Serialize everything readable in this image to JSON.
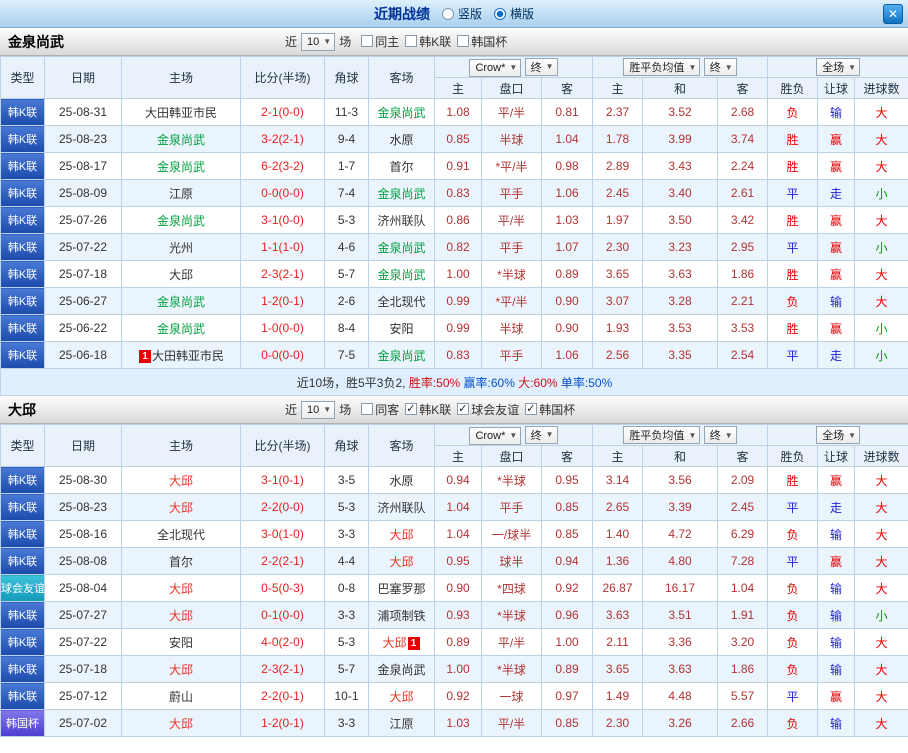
{
  "topbar": {
    "title": "近期战绩",
    "radio_vertical": "竖版",
    "radio_horizontal": "横版",
    "close_icon": "✕"
  },
  "filters_label": {
    "near": "近",
    "games": "场"
  },
  "header": {
    "cols": [
      "类型",
      "日期",
      "主场",
      "比分(半场)",
      "角球",
      "客场"
    ],
    "sub": [
      "主",
      "盘口",
      "客",
      "主",
      "和",
      "客",
      "胜负",
      "让球",
      "进球数"
    ],
    "selects": {
      "bookmaker": "Crow*",
      "final1": "终",
      "avg": "胜平负均值",
      "final2": "终",
      "scope": "全场"
    }
  },
  "colors": {
    "league_blue": "#1b4aab",
    "friendly_teal": "#149ab8",
    "cup_purple": "#4c3ecf",
    "result_red": "#e60000",
    "result_blue": "#2020d8",
    "result_green": "#0f9a10",
    "team_green": "#00a040",
    "team_red": "#ee3322",
    "score_red": "#e82020",
    "odds_red": "#b23333"
  },
  "sections": [
    {
      "team": "金泉尚武",
      "count": "10",
      "checks": [
        {
          "label": "同主",
          "on": false
        },
        {
          "label": "韩K联",
          "on": false
        },
        {
          "label": "韩国杯",
          "on": false
        }
      ],
      "rows": [
        {
          "type": "韩K联",
          "tc": "kl",
          "date": "25-08-31",
          "home": "大田韩亚市民",
          "hc": "",
          "hb": "",
          "score": "2-1(0-0)",
          "corners": "11-3",
          "away": "金泉尚武",
          "ac": "g",
          "ab": "",
          "odds": [
            "1.08",
            "平/半",
            "0.81"
          ],
          "euro": [
            "2.37",
            "3.52",
            "2.68"
          ],
          "res": [
            "负",
            "输",
            "大"
          ],
          "rc": [
            "r",
            "b",
            "r"
          ]
        },
        {
          "type": "韩K联",
          "tc": "kl",
          "date": "25-08-23",
          "home": "金泉尚武",
          "hc": "g",
          "hb": "",
          "score": "3-2(2-1)",
          "corners": "9-4",
          "away": "水原",
          "ac": "",
          "ab": "",
          "odds": [
            "0.85",
            "半球",
            "1.04"
          ],
          "euro": [
            "1.78",
            "3.99",
            "3.74"
          ],
          "res": [
            "胜",
            "赢",
            "大"
          ],
          "rc": [
            "r",
            "r",
            "r"
          ]
        },
        {
          "type": "韩K联",
          "tc": "kl",
          "date": "25-08-17",
          "home": "金泉尚武",
          "hc": "g",
          "hb": "",
          "score": "6-2(3-2)",
          "corners": "1-7",
          "away": "首尔",
          "ac": "",
          "ab": "",
          "odds": [
            "0.91",
            "*平/半",
            "0.98"
          ],
          "euro": [
            "2.89",
            "3.43",
            "2.24"
          ],
          "res": [
            "胜",
            "赢",
            "大"
          ],
          "rc": [
            "r",
            "r",
            "r"
          ]
        },
        {
          "type": "韩K联",
          "tc": "kl",
          "date": "25-08-09",
          "home": "江原",
          "hc": "",
          "hb": "",
          "score": "0-0(0-0)",
          "corners": "7-4",
          "away": "金泉尚武",
          "ac": "g",
          "ab": "",
          "odds": [
            "0.83",
            "平手",
            "1.06"
          ],
          "euro": [
            "2.45",
            "3.40",
            "2.61"
          ],
          "res": [
            "平",
            "走",
            "小"
          ],
          "rc": [
            "b",
            "b",
            "g"
          ]
        },
        {
          "type": "韩K联",
          "tc": "kl",
          "date": "25-07-26",
          "home": "金泉尚武",
          "hc": "g",
          "hb": "",
          "score": "3-1(0-0)",
          "corners": "5-3",
          "away": "济州联队",
          "ac": "",
          "ab": "",
          "odds": [
            "0.86",
            "平/半",
            "1.03"
          ],
          "euro": [
            "1.97",
            "3.50",
            "3.42"
          ],
          "res": [
            "胜",
            "赢",
            "大"
          ],
          "rc": [
            "r",
            "r",
            "r"
          ]
        },
        {
          "type": "韩K联",
          "tc": "kl",
          "date": "25-07-22",
          "home": "光州",
          "hc": "",
          "hb": "",
          "score": "1-1(1-0)",
          "corners": "4-6",
          "away": "金泉尚武",
          "ac": "g",
          "ab": "",
          "odds": [
            "0.82",
            "平手",
            "1.07"
          ],
          "euro": [
            "2.30",
            "3.23",
            "2.95"
          ],
          "res": [
            "平",
            "赢",
            "小"
          ],
          "rc": [
            "b",
            "r",
            "g"
          ]
        },
        {
          "type": "韩K联",
          "tc": "kl",
          "date": "25-07-18",
          "home": "大邱",
          "hc": "",
          "hb": "",
          "score": "2-3(2-1)",
          "corners": "5-7",
          "away": "金泉尚武",
          "ac": "g",
          "ab": "",
          "odds": [
            "1.00",
            "*半球",
            "0.89"
          ],
          "euro": [
            "3.65",
            "3.63",
            "1.86"
          ],
          "res": [
            "胜",
            "赢",
            "大"
          ],
          "rc": [
            "r",
            "r",
            "r"
          ]
        },
        {
          "type": "韩K联",
          "tc": "kl",
          "date": "25-06-27",
          "home": "金泉尚武",
          "hc": "g",
          "hb": "",
          "score": "1-2(0-1)",
          "corners": "2-6",
          "away": "全北现代",
          "ac": "",
          "ab": "",
          "odds": [
            "0.99",
            "*平/半",
            "0.90"
          ],
          "euro": [
            "3.07",
            "3.28",
            "2.21"
          ],
          "res": [
            "负",
            "输",
            "大"
          ],
          "rc": [
            "r",
            "b",
            "r"
          ]
        },
        {
          "type": "韩K联",
          "tc": "kl",
          "date": "25-06-22",
          "home": "金泉尚武",
          "hc": "g",
          "hb": "",
          "score": "1-0(0-0)",
          "corners": "8-4",
          "away": "安阳",
          "ac": "",
          "ab": "",
          "odds": [
            "0.99",
            "半球",
            "0.90"
          ],
          "euro": [
            "1.93",
            "3.53",
            "3.53"
          ],
          "res": [
            "胜",
            "赢",
            "小"
          ],
          "rc": [
            "r",
            "r",
            "g"
          ]
        },
        {
          "type": "韩K联",
          "tc": "kl",
          "date": "25-06-18",
          "home": "大田韩亚市民",
          "hc": "",
          "hb": "1",
          "score": "0-0(0-0)",
          "corners": "7-5",
          "away": "金泉尚武",
          "ac": "g",
          "ab": "",
          "odds": [
            "0.83",
            "平手",
            "1.06"
          ],
          "euro": [
            "2.56",
            "3.35",
            "2.54"
          ],
          "res": [
            "平",
            "走",
            "小"
          ],
          "rc": [
            "b",
            "b",
            "g"
          ]
        }
      ],
      "footer": [
        {
          "t": "近10场，胜5平3负2,  ",
          "c": "#333333"
        },
        {
          "t": "胜率:50%  ",
          "c": "#d01010"
        },
        {
          "t": "赢率:60%  ",
          "c": "#0550cc"
        },
        {
          "t": "大:60%  ",
          "c": "#d01010"
        },
        {
          "t": "单率:50%",
          "c": "#0550cc"
        }
      ]
    },
    {
      "team": "大邱",
      "count": "10",
      "checks": [
        {
          "label": "同客",
          "on": false
        },
        {
          "label": "韩K联",
          "on": true
        },
        {
          "label": "球会友谊",
          "on": true
        },
        {
          "label": "韩国杯",
          "on": true
        }
      ],
      "rows": [
        {
          "type": "韩K联",
          "tc": "kl",
          "date": "25-08-30",
          "home": "大邱",
          "hc": "r",
          "hb": "",
          "score": "3-1(0-1)",
          "corners": "3-5",
          "away": "水原",
          "ac": "",
          "ab": "",
          "odds": [
            "0.94",
            "*半球",
            "0.95"
          ],
          "euro": [
            "3.14",
            "3.56",
            "2.09"
          ],
          "res": [
            "胜",
            "赢",
            "大"
          ],
          "rc": [
            "r",
            "r",
            "r"
          ]
        },
        {
          "type": "韩K联",
          "tc": "kl",
          "date": "25-08-23",
          "home": "大邱",
          "hc": "r",
          "hb": "",
          "score": "2-2(0-0)",
          "corners": "5-3",
          "away": "济州联队",
          "ac": "",
          "ab": "",
          "odds": [
            "1.04",
            "平手",
            "0.85"
          ],
          "euro": [
            "2.65",
            "3.39",
            "2.45"
          ],
          "res": [
            "平",
            "走",
            "大"
          ],
          "rc": [
            "b",
            "b",
            "r"
          ]
        },
        {
          "type": "韩K联",
          "tc": "kl",
          "date": "25-08-16",
          "home": "全北现代",
          "hc": "",
          "hb": "",
          "score": "3-0(1-0)",
          "corners": "3-3",
          "away": "大邱",
          "ac": "r",
          "ab": "",
          "odds": [
            "1.04",
            "一/球半",
            "0.85"
          ],
          "euro": [
            "1.40",
            "4.72",
            "6.29"
          ],
          "res": [
            "负",
            "输",
            "大"
          ],
          "rc": [
            "r",
            "b",
            "r"
          ]
        },
        {
          "type": "韩K联",
          "tc": "kl",
          "date": "25-08-08",
          "home": "首尔",
          "hc": "",
          "hb": "",
          "score": "2-2(2-1)",
          "corners": "4-4",
          "away": "大邱",
          "ac": "r",
          "ab": "",
          "odds": [
            "0.95",
            "球半",
            "0.94"
          ],
          "euro": [
            "1.36",
            "4.80",
            "7.28"
          ],
          "res": [
            "平",
            "赢",
            "大"
          ],
          "rc": [
            "b",
            "r",
            "r"
          ]
        },
        {
          "type": "球会友谊",
          "tc": "fr",
          "date": "25-08-04",
          "home": "大邱",
          "hc": "r",
          "hb": "",
          "score": "0-5(0-3)",
          "corners": "0-8",
          "away": "巴塞罗那",
          "ac": "",
          "ab": "",
          "odds": [
            "0.90",
            "*四球",
            "0.92"
          ],
          "euro": [
            "26.87",
            "16.17",
            "1.04"
          ],
          "res": [
            "负",
            "输",
            "大"
          ],
          "rc": [
            "r",
            "b",
            "r"
          ]
        },
        {
          "type": "韩K联",
          "tc": "kl",
          "date": "25-07-27",
          "home": "大邱",
          "hc": "r",
          "hb": "",
          "score": "0-1(0-0)",
          "corners": "3-3",
          "away": "浦项制铁",
          "ac": "",
          "ab": "",
          "odds": [
            "0.93",
            "*半球",
            "0.96"
          ],
          "euro": [
            "3.63",
            "3.51",
            "1.91"
          ],
          "res": [
            "负",
            "输",
            "小"
          ],
          "rc": [
            "r",
            "b",
            "g"
          ]
        },
        {
          "type": "韩K联",
          "tc": "kl",
          "date": "25-07-22",
          "home": "安阳",
          "hc": "",
          "hb": "",
          "score": "4-0(2-0)",
          "corners": "5-3",
          "away": "大邱",
          "ac": "r",
          "ab": "1",
          "odds": [
            "0.89",
            "平/半",
            "1.00"
          ],
          "euro": [
            "2.11",
            "3.36",
            "3.20"
          ],
          "res": [
            "负",
            "输",
            "大"
          ],
          "rc": [
            "r",
            "b",
            "r"
          ]
        },
        {
          "type": "韩K联",
          "tc": "kl",
          "date": "25-07-18",
          "home": "大邱",
          "hc": "r",
          "hb": "",
          "score": "2-3(2-1)",
          "corners": "5-7",
          "away": "金泉尚武",
          "ac": "",
          "ab": "",
          "odds": [
            "1.00",
            "*半球",
            "0.89"
          ],
          "euro": [
            "3.65",
            "3.63",
            "1.86"
          ],
          "res": [
            "负",
            "输",
            "大"
          ],
          "rc": [
            "r",
            "b",
            "r"
          ]
        },
        {
          "type": "韩K联",
          "tc": "kl",
          "date": "25-07-12",
          "home": "蔚山",
          "hc": "",
          "hb": "",
          "score": "2-2(0-1)",
          "corners": "10-1",
          "away": "大邱",
          "ac": "r",
          "ab": "",
          "odds": [
            "0.92",
            "一球",
            "0.97"
          ],
          "euro": [
            "1.49",
            "4.48",
            "5.57"
          ],
          "res": [
            "平",
            "赢",
            "大"
          ],
          "rc": [
            "b",
            "r",
            "r"
          ]
        },
        {
          "type": "韩国杯",
          "tc": "cup",
          "date": "25-07-02",
          "home": "大邱",
          "hc": "r",
          "hb": "",
          "score": "1-2(0-1)",
          "corners": "3-3",
          "away": "江原",
          "ac": "",
          "ab": "",
          "odds": [
            "1.03",
            "平/半",
            "0.85"
          ],
          "euro": [
            "2.30",
            "3.26",
            "2.66"
          ],
          "res": [
            "负",
            "输",
            "大"
          ],
          "rc": [
            "r",
            "b",
            "r"
          ]
        }
      ]
    }
  ]
}
